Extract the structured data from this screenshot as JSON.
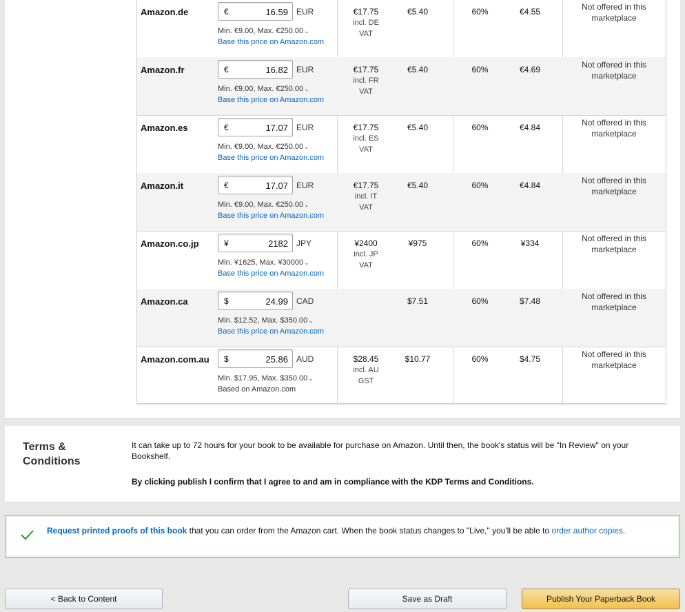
{
  "pricing_rows": [
    {
      "marketplace": "Amazon.de",
      "symbol": "€",
      "price": "16.59",
      "currency": "EUR",
      "minmax": "Min. €9.00, Max. €250.00",
      "base": "Base this price on Amazon.com",
      "base_is_link": true,
      "list_price": "€17.75",
      "vat_note": "incl. DE VAT",
      "printing": "€5.40",
      "rate": "60%",
      "royalty": "€4.55",
      "expanded": "Not offered in this marketplace"
    },
    {
      "marketplace": "Amazon.fr",
      "symbol": "€",
      "price": "16.82",
      "currency": "EUR",
      "minmax": "Min. €9.00, Max. €250.00",
      "base": "Base this price on Amazon.com",
      "base_is_link": true,
      "list_price": "€17.75",
      "vat_note": "incl. FR VAT",
      "printing": "€5.40",
      "rate": "60%",
      "royalty": "€4.69",
      "expanded": "Not offered in this marketplace"
    },
    {
      "marketplace": "Amazon.es",
      "symbol": "€",
      "price": "17.07",
      "currency": "EUR",
      "minmax": "Min. €9.00, Max. €250.00",
      "base": "Base this price on Amazon.com",
      "base_is_link": true,
      "list_price": "€17.75",
      "vat_note": "incl. ES VAT",
      "printing": "€5.40",
      "rate": "60%",
      "royalty": "€4.84",
      "expanded": "Not offered in this marketplace"
    },
    {
      "marketplace": "Amazon.it",
      "symbol": "€",
      "price": "17.07",
      "currency": "EUR",
      "minmax": "Min. €9.00, Max. €250.00",
      "base": "Base this price on Amazon.com",
      "base_is_link": true,
      "list_price": "€17.75",
      "vat_note": "incl. IT VAT",
      "printing": "€5.40",
      "rate": "60%",
      "royalty": "€4.84",
      "expanded": "Not offered in this marketplace"
    },
    {
      "marketplace": "Amazon.co.jp",
      "symbol": "¥",
      "price": "2182",
      "currency": "JPY",
      "minmax": "Min. ¥1625, Max. ¥30000",
      "base": "Base this price on Amazon.com",
      "base_is_link": true,
      "list_price": "¥2400",
      "vat_note": "incl. JP VAT",
      "printing": "¥975",
      "rate": "60%",
      "royalty": "¥334",
      "expanded": "Not offered in this marketplace"
    },
    {
      "marketplace": "Amazon.ca",
      "symbol": "$",
      "price": "24.99",
      "currency": "CAD",
      "minmax": "Min. $12.52, Max. $350.00",
      "base": "Base this price on Amazon.com",
      "base_is_link": true,
      "list_price": "",
      "vat_note": "",
      "printing": "$7.51",
      "rate": "60%",
      "royalty": "$7.48",
      "expanded": "Not offered in this marketplace"
    },
    {
      "marketplace": "Amazon.com.au",
      "symbol": "$",
      "price": "25.86",
      "currency": "AUD",
      "minmax": "Min. $17.95, Max. $350.00",
      "base": "Based on Amazon.com",
      "base_is_link": false,
      "list_price": "$28.45",
      "vat_note": "incl. AU GST",
      "printing": "$10.77",
      "rate": "60%",
      "royalty": "$4.75",
      "expanded": "Not offered in this marketplace"
    }
  ],
  "terms": {
    "heading": "Terms & Conditions",
    "availability": "It can take up to 72 hours for your book to be available for purchase on Amazon. Until then, the book's status will be \"In Review\" on your Bookshelf.",
    "agreement": "By clicking publish I confirm that I agree to and am in compliance with the KDP Terms and Conditions."
  },
  "proof_notice": {
    "link_request": "Request printed proofs of this book",
    "text_middle": " that you can order from the Amazon cart. When the book status changes to \"Live,\" you'll be able to ",
    "link_order": "order author copies",
    "text_end": "."
  },
  "buttons": {
    "back": "< Back to Content",
    "save": "Save as Draft",
    "publish": "Publish Your Paperback Book"
  },
  "colors": {
    "link": "#0066c0",
    "publish_button": "#f0c14b",
    "success_border": "#7ec17e",
    "check": "#2e9b2e"
  }
}
